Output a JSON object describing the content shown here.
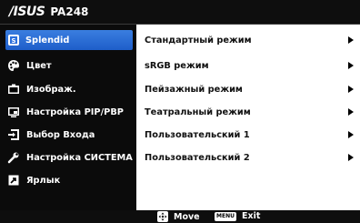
{
  "header": {
    "brand": "/ISUS",
    "model": "PA248"
  },
  "menu": {
    "items": [
      {
        "label": "Splendid",
        "icon": "splendid-icon",
        "active": true
      },
      {
        "label": "Цвет",
        "icon": "palette-icon",
        "active": false
      },
      {
        "label": "Изображ.",
        "icon": "image-icon",
        "active": false
      },
      {
        "label": "Настройка PIP/PBP",
        "icon": "pip-icon",
        "active": false
      },
      {
        "label": "Выбор Входа",
        "icon": "input-select-icon",
        "active": false
      },
      {
        "label": "Настройка СИСТЕМА",
        "icon": "wrench-icon",
        "active": false
      },
      {
        "label": "Ярлык",
        "icon": "shortcut-icon",
        "active": false
      }
    ]
  },
  "options": [
    {
      "label": "Стандартный режим",
      "has_submenu": true
    },
    {
      "label": "sRGB режим",
      "has_submenu": true
    },
    {
      "label": "Пейзажный режим",
      "has_submenu": true
    },
    {
      "label": "Театральный режим",
      "has_submenu": true
    },
    {
      "label": "Пользовательский 1",
      "has_submenu": true
    },
    {
      "label": "Пользовательский 2",
      "has_submenu": true
    }
  ],
  "footer": {
    "move_label": "Move",
    "menu_key": "MENU",
    "exit_label": "Exit"
  },
  "colors": {
    "active_bg": "#2b6fdc",
    "panel_bg": "#0b0b0b",
    "content_bg": "#ffffff"
  }
}
